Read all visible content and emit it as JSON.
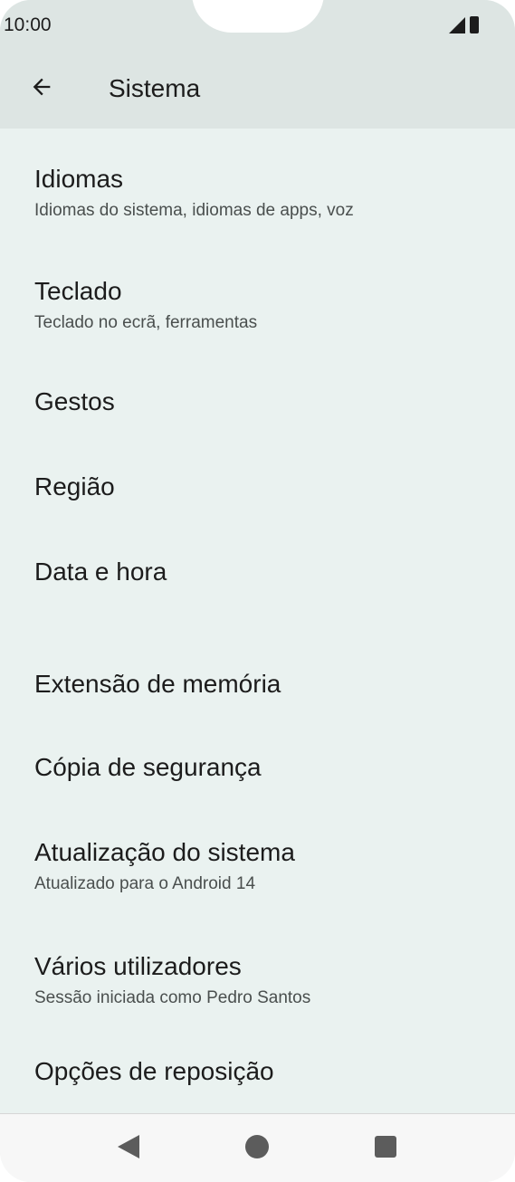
{
  "status_bar": {
    "time": "10:00",
    "icons": [
      "signal-icon",
      "battery-icon"
    ]
  },
  "toolbar": {
    "back_icon": "arrow-back-icon",
    "title": "Sistema"
  },
  "settings": {
    "items": [
      {
        "title": "Idiomas",
        "subtitle": "Idiomas do sistema, idiomas de apps, voz"
      },
      {
        "title": "Teclado",
        "subtitle": "Teclado no ecrã, ferramentas"
      },
      {
        "title": "Gestos"
      },
      {
        "title": "Região"
      },
      {
        "title": "Data e hora"
      },
      {
        "title": "Extensão de memória"
      },
      {
        "title": "Cópia de segurança"
      },
      {
        "title": "Atualização do sistema",
        "subtitle": "Atualizado para o Android 14"
      },
      {
        "title": "Vários utilizadores",
        "subtitle": "Sessão iniciada como Pedro Santos"
      },
      {
        "title": "Opções de reposição"
      }
    ]
  },
  "nav_bar": {
    "icons": [
      "nav-back-icon",
      "nav-home-icon",
      "nav-recents-icon"
    ]
  },
  "colors": {
    "background": "#eaf2f0",
    "header": "#dde5e3",
    "text_primary": "#1c1c1c",
    "text_secondary": "#4a4f4e"
  }
}
